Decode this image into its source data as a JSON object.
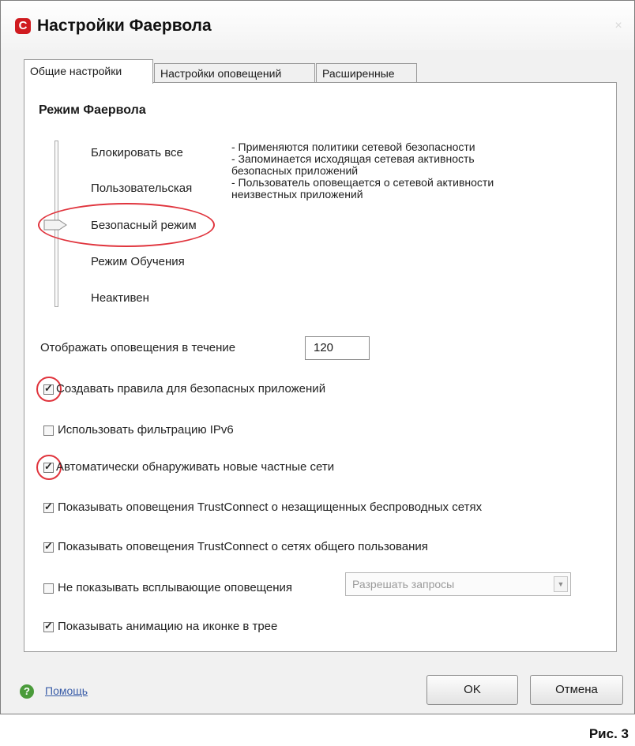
{
  "window": {
    "title": "Настройки Фаервола",
    "app_icon": "shield-icon",
    "close": "×"
  },
  "tabs": [
    {
      "label": "Общие настройки",
      "active": true
    },
    {
      "label": "Настройки оповещений",
      "active": false
    },
    {
      "label": "Расширенные",
      "active": false
    }
  ],
  "firewall_mode": {
    "title": "Режим Фаервола",
    "modes": [
      "Блокировать все",
      "Пользовательская",
      "Безопасный режим",
      "Режим Обучения",
      "Неактивен"
    ],
    "selected": "Безопасный режим",
    "description": [
      "- Применяются политики сетевой безопасности",
      "- Запоминается исходящая сетевая активность",
      "безопасных приложений",
      "- Пользователь оповещается о сетевой активности",
      "неизвестных приложений"
    ]
  },
  "notify_duration": {
    "label": "Отображать оповещения в течение",
    "value": "120"
  },
  "options": [
    {
      "label": "Создавать правила для безопасных приложений",
      "checked": true
    },
    {
      "label": "Использовать фильтрацию IPv6",
      "checked": false
    },
    {
      "label": "Автоматически обнаруживать новые частные сети",
      "checked": true
    },
    {
      "label": "Показывать оповещения TrustConnect о незащищенных беспроводных сетях",
      "checked": true
    },
    {
      "label": "Показывать оповещения TrustConnect о сетях общего пользования",
      "checked": true
    },
    {
      "label": "Не показывать всплывающие оповещения",
      "checked": false
    },
    {
      "label": "Показывать анимацию на иконке в трее",
      "checked": true
    }
  ],
  "popup_select": {
    "value": "Разрешать запросы"
  },
  "footer": {
    "help": "Помощь",
    "ok": "OK",
    "cancel": "Отмена"
  },
  "figure_caption": "Рис. 3",
  "colors": {
    "highlight_red": "#e0343d",
    "brand_red": "#d01b20",
    "help_green": "#4a9b3a"
  }
}
